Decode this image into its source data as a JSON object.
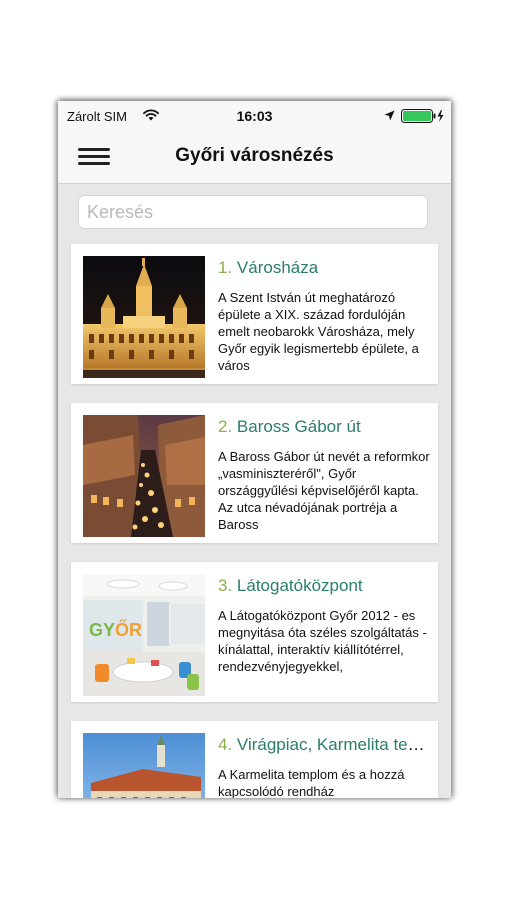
{
  "status": {
    "carrier": "Zárolt SIM",
    "time": "16:03",
    "battery_color": "#34c759"
  },
  "nav": {
    "title": "Győri városnézés"
  },
  "search": {
    "placeholder": "Keresés",
    "value": ""
  },
  "accent": {
    "number_color": "#8cb04a",
    "title_color": "#2b7d6b"
  },
  "items": [
    {
      "number": "1.",
      "title": "Városháza",
      "description": "A Szent István út meghatározó épülete a XIX. század fordulóján emelt neobarokk Városháza, mely Győr egyik legismertebb épülete, a város",
      "image": "city-hall-night-photo"
    },
    {
      "number": "2.",
      "title": "Baross Gábor út",
      "description": "A Baross Gábor út nevét a reformkor „vasminiszteréről\", Győr országgyűlési képviselőjéről kapta. Az utca névadójának portréja a Baross",
      "image": "street-evening-photo"
    },
    {
      "number": "3.",
      "title": "Látogatóközpont",
      "description": "A Látogatóközpont Győr 2012 - es megnyitása óta széles szolgáltatás - kínálattal, interaktív kiállítótérrel, rendezvényjegyekkel,",
      "image": "visitor-center-photo"
    },
    {
      "number": "4.",
      "title": "Virágpiac, Karmelita templom",
      "description": "A Karmelita templom és a hozzá kapcsolódó rendház",
      "image": "carmelite-church-photo"
    }
  ]
}
